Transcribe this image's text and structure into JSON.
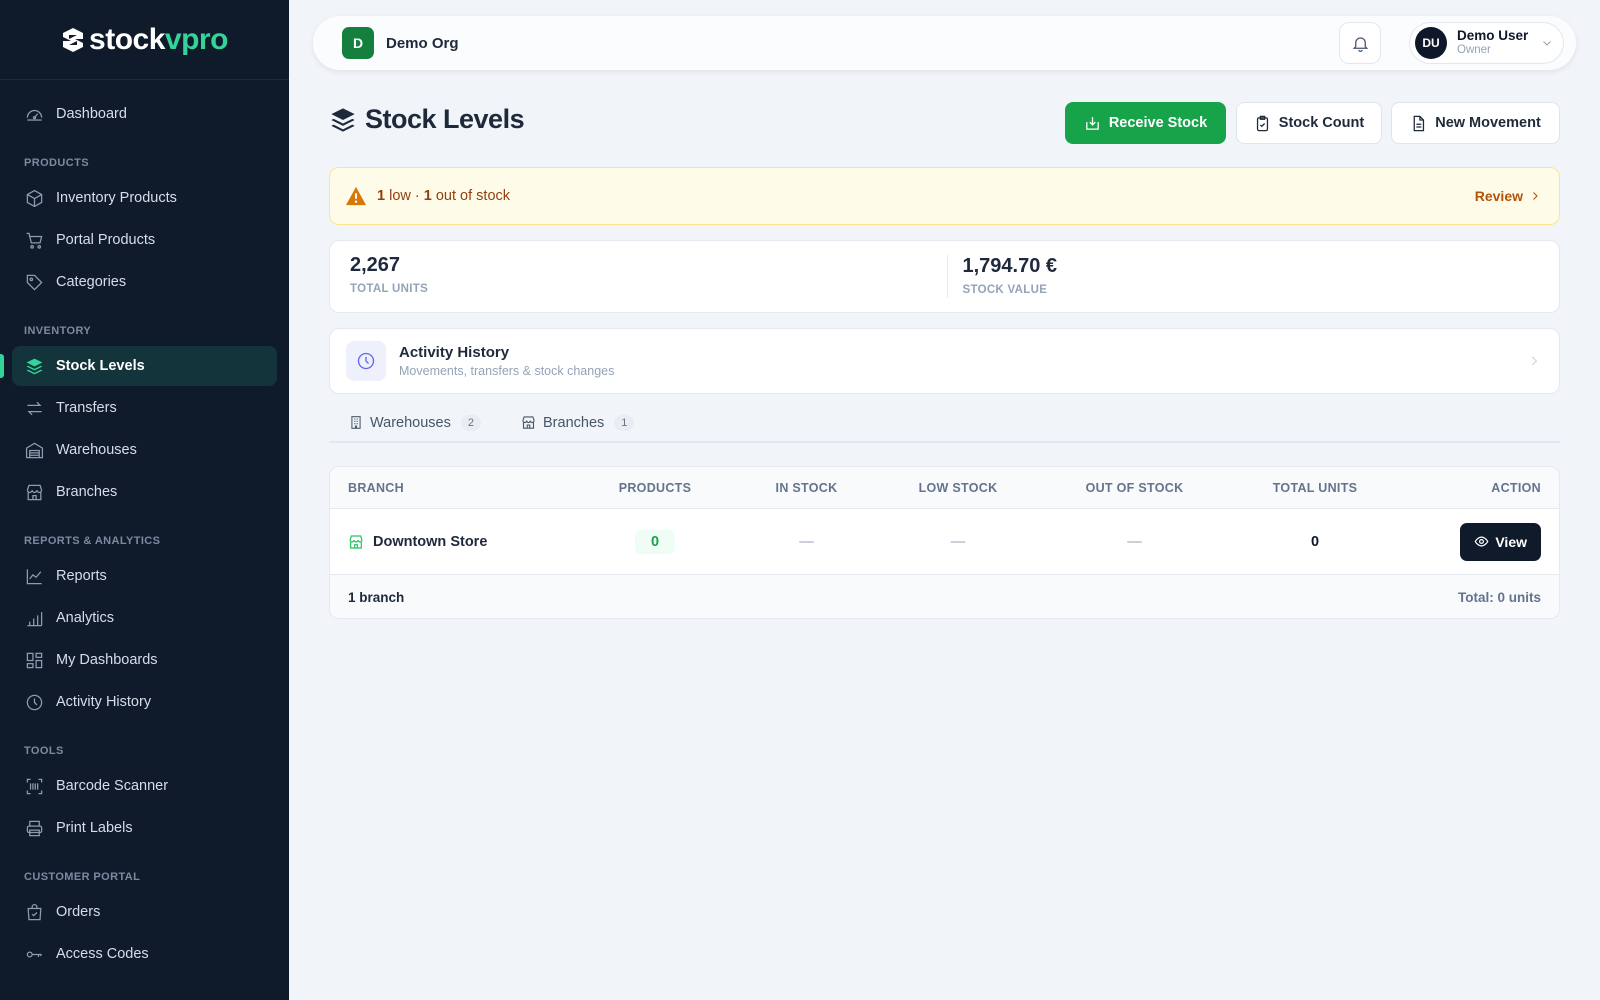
{
  "brand": {
    "part1": "stock",
    "part2": "vpro",
    "accent": "#34d399"
  },
  "sidebar": {
    "top": [
      {
        "label": "Dashboard",
        "icon": "gauge-icon"
      }
    ],
    "sections": [
      {
        "title": "PRODUCTS",
        "items": [
          {
            "label": "Inventory Products",
            "icon": "box-icon"
          },
          {
            "label": "Portal Products",
            "icon": "cart-icon"
          },
          {
            "label": "Categories",
            "icon": "tag-icon"
          }
        ]
      },
      {
        "title": "INVENTORY",
        "items": [
          {
            "label": "Stock Levels",
            "icon": "layers-icon",
            "active": true
          },
          {
            "label": "Transfers",
            "icon": "arrows-icon"
          },
          {
            "label": "Warehouses",
            "icon": "warehouse-icon"
          },
          {
            "label": "Branches",
            "icon": "store-icon"
          }
        ]
      },
      {
        "title": "REPORTS & ANALYTICS",
        "items": [
          {
            "label": "Reports",
            "icon": "line-chart-icon"
          },
          {
            "label": "Analytics",
            "icon": "bar-chart-icon"
          },
          {
            "label": "My Dashboards",
            "icon": "grid-icon"
          },
          {
            "label": "Activity History",
            "icon": "clock-icon"
          }
        ]
      },
      {
        "title": "TOOLS",
        "items": [
          {
            "label": "Barcode Scanner",
            "icon": "barcode-icon"
          },
          {
            "label": "Print Labels",
            "icon": "printer-icon"
          }
        ]
      },
      {
        "title": "CUSTOMER PORTAL",
        "items": [
          {
            "label": "Orders",
            "icon": "bag-icon"
          },
          {
            "label": "Access Codes",
            "icon": "key-icon"
          }
        ]
      }
    ]
  },
  "topbar": {
    "org_initial": "D",
    "org_name": "Demo Org",
    "user_initials": "DU",
    "user_name": "Demo User",
    "user_role": "Owner"
  },
  "header": {
    "title": "Stock Levels",
    "receive_label": "Receive Stock",
    "count_label": "Stock Count",
    "movement_label": "New Movement"
  },
  "alert": {
    "low_count": "1",
    "low_label": " low · ",
    "out_count": "1",
    "out_label": " out of stock",
    "review_label": "Review"
  },
  "stats": {
    "total_units": "2,267",
    "total_units_label": "TOTAL UNITS",
    "stock_value": "1,794.70 €",
    "stock_value_label": "STOCK VALUE"
  },
  "activity": {
    "title": "Activity History",
    "subtitle": "Movements, transfers & stock changes"
  },
  "tabs": [
    {
      "label": "Warehouses",
      "count": "2"
    },
    {
      "label": "Branches",
      "count": "1"
    }
  ],
  "table": {
    "columns": [
      "BRANCH",
      "PRODUCTS",
      "IN STOCK",
      "LOW STOCK",
      "OUT OF STOCK",
      "TOTAL UNITS",
      "ACTION"
    ],
    "rows": [
      {
        "branch": "Downtown Store",
        "products": "0",
        "in_stock": "—",
        "low_stock": "—",
        "out_of_stock": "—",
        "total_units": "0",
        "action": "View"
      }
    ],
    "footer_count": "1 branch",
    "footer_total": "Total: 0 units"
  }
}
